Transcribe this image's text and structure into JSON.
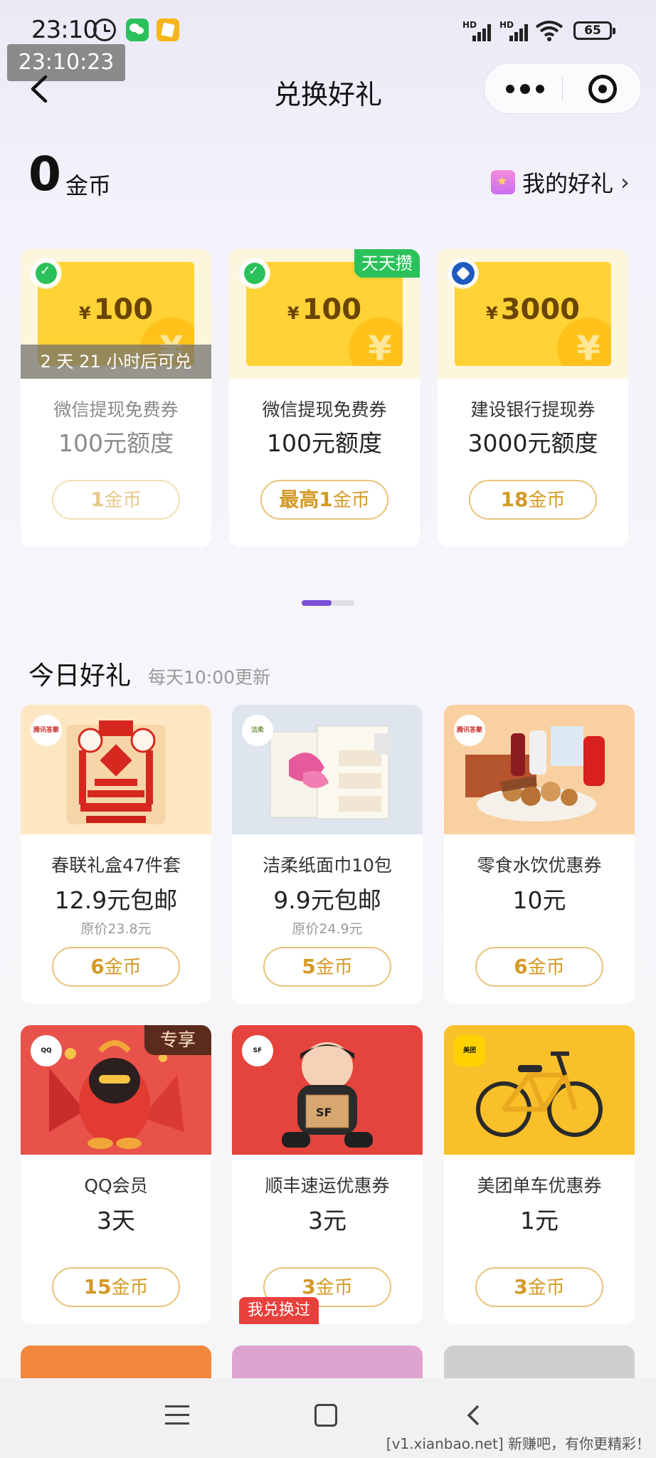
{
  "status_bar": {
    "time": "23:10",
    "battery": "65",
    "overlay_clock": "23:10:23"
  },
  "nav": {
    "title": "兑换好礼"
  },
  "coins": {
    "count": "0",
    "label": "金币",
    "my_gifts": "我的好礼"
  },
  "vouchers": [
    {
      "amount": "100",
      "currency": "¥",
      "name": "微信提现免费券",
      "quota": "100元额度",
      "price_prefix": "",
      "price": "1",
      "unit": "金币",
      "countdown": "2 天 21 小时后可兑",
      "tag": "",
      "brand": "wechat-icon",
      "dimmed": true
    },
    {
      "amount": "100",
      "currency": "¥",
      "name": "微信提现免费券",
      "quota": "100元额度",
      "price_prefix": "最高",
      "price": "1",
      "unit": "金币",
      "countdown": "",
      "tag": "天天攒",
      "brand": "wechat-icon",
      "dimmed": false
    },
    {
      "amount": "3000",
      "currency": "¥",
      "name": "建设银行提现券",
      "quota": "3000元额度",
      "price_prefix": "",
      "price": "18",
      "unit": "金币",
      "countdown": "",
      "tag": "",
      "brand": "ccb-icon",
      "dimmed": false
    }
  ],
  "pager": {
    "active_index": 0,
    "count": 2
  },
  "today": {
    "title": "今日好礼",
    "subtitle": "每天10:00更新"
  },
  "gifts": [
    {
      "name": "春联礼盒47件套",
      "price": "12.9元包邮",
      "orig": "原价23.8元",
      "coin": "6",
      "unit": "金币",
      "shop": "腾讯答聚",
      "img": "couplets-image"
    },
    {
      "name": "洁柔纸面巾10包",
      "price": "9.9元包邮",
      "orig": "原价24.9元",
      "coin": "5",
      "unit": "金币",
      "shop": "洁柔",
      "img": "tissue-image"
    },
    {
      "name": "零食水饮优惠券",
      "price": "10元",
      "orig": "",
      "coin": "6",
      "unit": "金币",
      "shop": "腾讯答聚",
      "img": "snacks-image"
    },
    {
      "name": "QQ会员",
      "price": "3天",
      "orig": "",
      "coin": "15",
      "unit": "金币",
      "shop": "QQ",
      "tag": "专享",
      "img": "qq-penguin-image"
    },
    {
      "name": "顺丰速运优惠券",
      "price": "3元",
      "orig": "",
      "coin": "3",
      "unit": "金币",
      "shop": "SF",
      "tag_redeemed": "我兑换过",
      "img": "sf-courier-image"
    },
    {
      "name": "美团单车优惠券",
      "price": "1元",
      "orig": "",
      "coin": "3",
      "unit": "金币",
      "shop": "美团",
      "img": "bicycle-image"
    }
  ],
  "watermark": "[v1.xianbao.net] 新赚吧，有你更精彩！"
}
